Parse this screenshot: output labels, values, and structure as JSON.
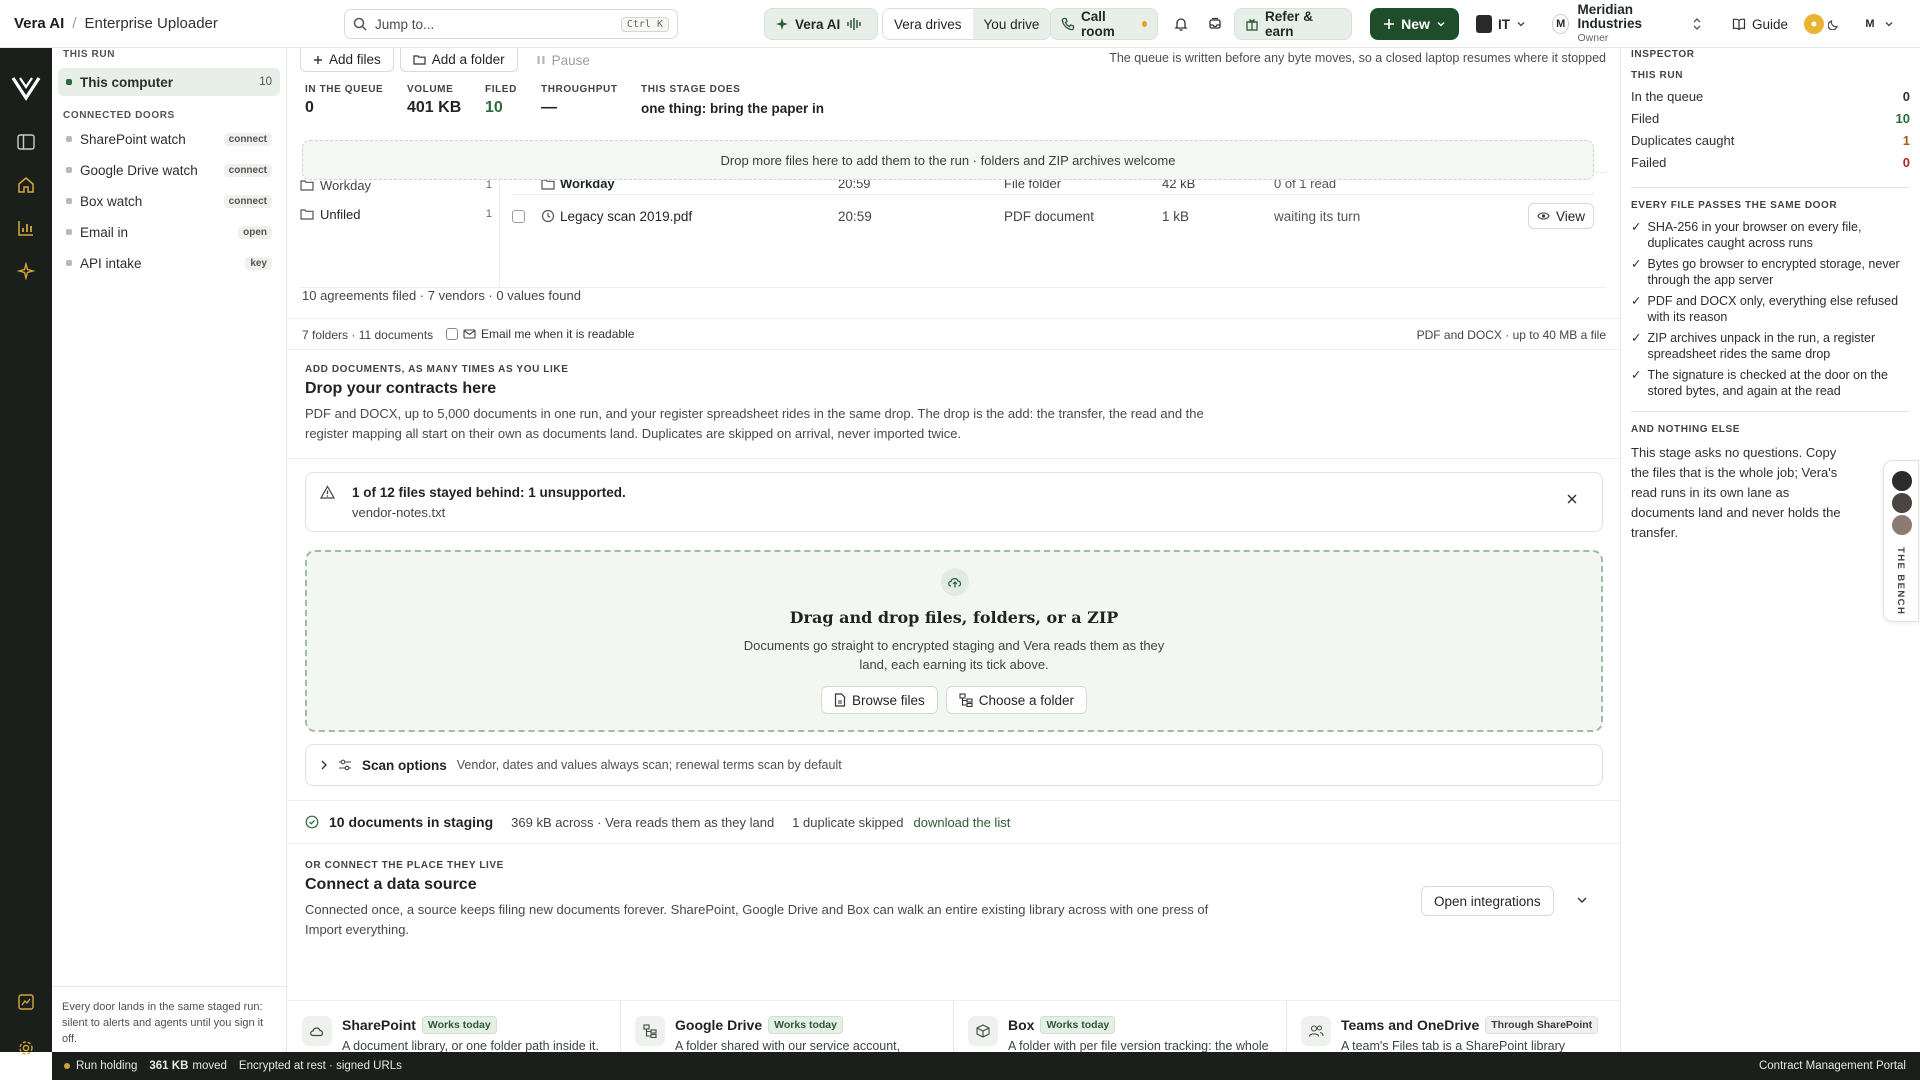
{
  "header": {
    "app_name": "Vera AI",
    "breadcrumb_sep": "/",
    "page_name": "Enterprise Uploader",
    "search_placeholder": "Jump to...",
    "search_shortcut": "Ctrl K",
    "vera_ai": "Vera AI",
    "drive_toggle": [
      "Vera drives",
      "You drive"
    ],
    "call_room": "Call room",
    "refer": "Refer & earn",
    "new": "New",
    "workspace_short": "IT",
    "org_initial": "M",
    "org_name": "Meridian Industries",
    "org_role": "Owner",
    "guide": "Guide",
    "user_initial": "M"
  },
  "sidebar": {
    "this_run_label": "THIS RUN",
    "this_computer": "This computer",
    "this_computer_count": "10",
    "connected_doors_label": "CONNECTED DOORS",
    "doors": [
      {
        "label": "SharePoint watch",
        "tag": "connect"
      },
      {
        "label": "Google Drive watch",
        "tag": "connect"
      },
      {
        "label": "Box watch",
        "tag": "connect"
      },
      {
        "label": "Email in",
        "tag": "open"
      },
      {
        "label": "API intake",
        "tag": "key"
      }
    ],
    "footer": "Every door lands in the same staged run: silent to alerts and agents until you sign it off."
  },
  "toolbar": {
    "add_files": "Add files",
    "add_folder": "Add a folder",
    "pause": "Pause",
    "note": "The queue is written before any byte moves, so a closed laptop resumes where it stopped"
  },
  "stats": [
    {
      "label": "IN THE QUEUE",
      "value": "0"
    },
    {
      "label": "VOLUME",
      "value": "401 KB"
    },
    {
      "label": "FILED",
      "value": "10"
    },
    {
      "label": "THROUGHPUT",
      "value": "—"
    },
    {
      "label": "THIS STAGE DOES",
      "value": "one thing: bring the paper in"
    }
  ],
  "dropstrip": "Drop more files here to add them to the run · folders and ZIP archives welcome",
  "folders": [
    {
      "name": "Workday",
      "count": "1"
    },
    {
      "name": "Unfiled",
      "count": "1"
    }
  ],
  "files": [
    {
      "name": "Workday",
      "time": "20:59",
      "type": "File folder",
      "size": "42 kB",
      "status": "0 of 1 read"
    },
    {
      "name": "Legacy scan 2019.pdf",
      "time": "20:59",
      "type": "PDF document",
      "size": "1 kB",
      "status": "waiting its turn",
      "action": "View"
    }
  ],
  "summary": "10 agreements filed · 7 vendors · 0 values found",
  "meta": {
    "counts": "7 folders · 11 documents",
    "email_me": "Email me when it is readable",
    "limits": "PDF and DOCX · up to 40 MB a file"
  },
  "add_section": {
    "eyebrow": "ADD DOCUMENTS, AS MANY TIMES AS YOU LIKE",
    "title": "Drop your contracts here",
    "body": "PDF and DOCX, up to 5,000 documents in one run, and your register spreadsheet rides in the same drop. The drop is the add: the transfer, the read and the register mapping all start on their own as documents land. Duplicates are skipped on arrival, never imported twice."
  },
  "alert": {
    "title": "1 of 12 files stayed behind: 1 unsupported.",
    "file": "vendor-notes.txt"
  },
  "dropzone": {
    "title": "Drag and drop files, folders, or a ZIP",
    "body": "Documents go straight to encrypted staging and Vera reads them as they land, each earning its tick above.",
    "browse": "Browse files",
    "choose": "Choose a folder"
  },
  "scan": {
    "title": "Scan options",
    "desc": "Vendor, dates and values always scan; renewal terms scan by default"
  },
  "staging": {
    "title": "10 documents in staging",
    "detail": "369 kB across · Vera reads them as they land",
    "dupes": "1 duplicate skipped",
    "link": "download the list"
  },
  "connect": {
    "eyebrow": "OR CONNECT THE PLACE THEY LIVE",
    "title": "Connect a data source",
    "body": "Connected once, a source keeps filing new documents forever. SharePoint, Google Drive and Box can walk an entire existing library across with one press of Import everything.",
    "open": "Open integrations"
  },
  "sources": [
    {
      "name": "SharePoint",
      "badge": "Works today",
      "desc": "A document library, or one folder path inside it. Import everything walks the whole library across in the background."
    },
    {
      "name": "Google Drive",
      "badge": "Works today",
      "desc": "A folder shared with our service account, shared drives included, subfolders and all."
    },
    {
      "name": "Box",
      "badge": "Works today",
      "desc": "A folder with per file version tracking: the whole backlog first, then new files and new versions daily."
    },
    {
      "name": "Teams and OneDrive",
      "badge": "Through SharePoint",
      "desc": "A team's Files tab is a SharePoint library underneath. Point the SharePoint connector at its drive."
    }
  ],
  "inspector": {
    "title": "INSPECTOR",
    "run_label": "THIS RUN",
    "rows": [
      {
        "label": "In the queue",
        "value": "0",
        "color": "#1f2421"
      },
      {
        "label": "Filed",
        "value": "10",
        "color": "#2d6a3e"
      },
      {
        "label": "Duplicates caught",
        "value": "1",
        "color": "#a0620f"
      },
      {
        "label": "Failed",
        "value": "0",
        "color": "#b3261e"
      }
    ],
    "door_label": "EVERY FILE PASSES THE SAME DOOR",
    "checks": [
      "SHA-256 in your browser on every file, duplicates caught across runs",
      "Bytes go browser to encrypted storage, never through the app server",
      "PDF and DOCX only, everything else refused with its reason",
      "ZIP archives unpack in the run, a register spreadsheet rides the same drop",
      "The signature is checked at the door on the stored bytes, and again at the read"
    ],
    "nothing_label": "AND NOTHING ELSE",
    "nothing_body": "This stage asks no questions. Copy the files that is the whole job; Vera's read runs in its own lane as documents land and never holds the transfer."
  },
  "bench": "THE BENCH",
  "status": {
    "holding": "Run holding",
    "moved_value": "361 KB",
    "moved_label": "moved",
    "encrypted": "Encrypted at rest · signed URLs",
    "portal": "Contract Management Portal"
  }
}
